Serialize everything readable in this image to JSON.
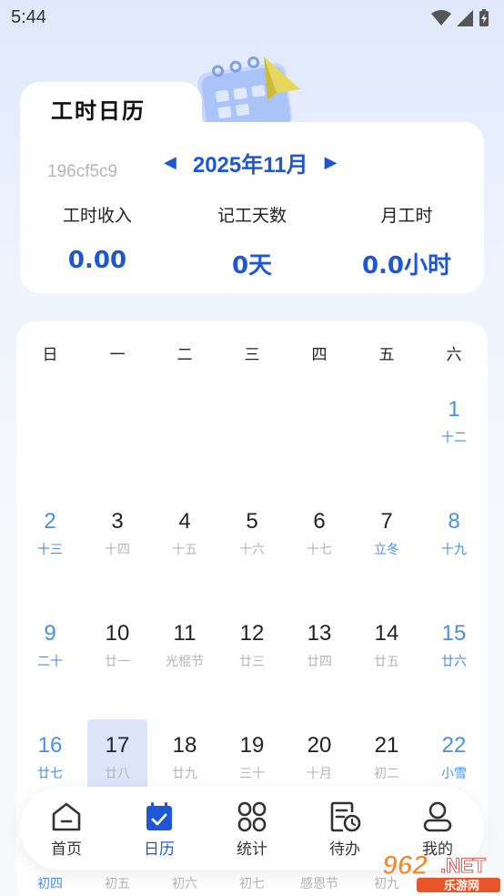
{
  "status": {
    "time": "5:44"
  },
  "header": {
    "title": "工时日历",
    "device_id": "196cf5c9",
    "month": "2025年11月"
  },
  "stats": [
    {
      "label": "工时收入",
      "value": "0.00"
    },
    {
      "label": "记工天数",
      "value": "0天"
    },
    {
      "label": "月工时",
      "value": "0.0小时"
    }
  ],
  "weekdays": [
    "日",
    "一",
    "二",
    "三",
    "四",
    "五",
    "六"
  ],
  "days": [
    {
      "n": "1",
      "l": "十二"
    },
    {
      "n": "2",
      "l": "十三"
    },
    {
      "n": "3",
      "l": "十四"
    },
    {
      "n": "4",
      "l": "十五"
    },
    {
      "n": "5",
      "l": "十六"
    },
    {
      "n": "6",
      "l": "十七"
    },
    {
      "n": "7",
      "l": "立冬"
    },
    {
      "n": "8",
      "l": "十九"
    },
    {
      "n": "9",
      "l": "二十"
    },
    {
      "n": "10",
      "l": "廿一"
    },
    {
      "n": "11",
      "l": "光棍节"
    },
    {
      "n": "12",
      "l": "廿三"
    },
    {
      "n": "13",
      "l": "廿四"
    },
    {
      "n": "14",
      "l": "廿五"
    },
    {
      "n": "15",
      "l": "廿六"
    },
    {
      "n": "16",
      "l": "廿七"
    },
    {
      "n": "17",
      "l": "廿八"
    },
    {
      "n": "18",
      "l": "廿九"
    },
    {
      "n": "19",
      "l": "三十"
    },
    {
      "n": "20",
      "l": "十月"
    },
    {
      "n": "21",
      "l": "初二"
    },
    {
      "n": "22",
      "l": "小雪"
    }
  ],
  "peek_lunar": [
    "初四",
    "初五",
    "初六",
    "初七",
    "感恩节",
    "初九"
  ],
  "nav": {
    "items": [
      {
        "label": "首页",
        "icon": "home-icon"
      },
      {
        "label": "日历",
        "icon": "calendar-icon",
        "active": true
      },
      {
        "label": "统计",
        "icon": "stats-icon"
      },
      {
        "label": "待办",
        "icon": "todo-icon"
      },
      {
        "label": "我的",
        "icon": "profile-icon"
      }
    ]
  },
  "watermark": {
    "text": "962.NET",
    "sub": "乐游网"
  },
  "colors": {
    "accent": "#1d57d6",
    "weekend": "#4a90e2",
    "today_bg": "#dbe6fb"
  }
}
